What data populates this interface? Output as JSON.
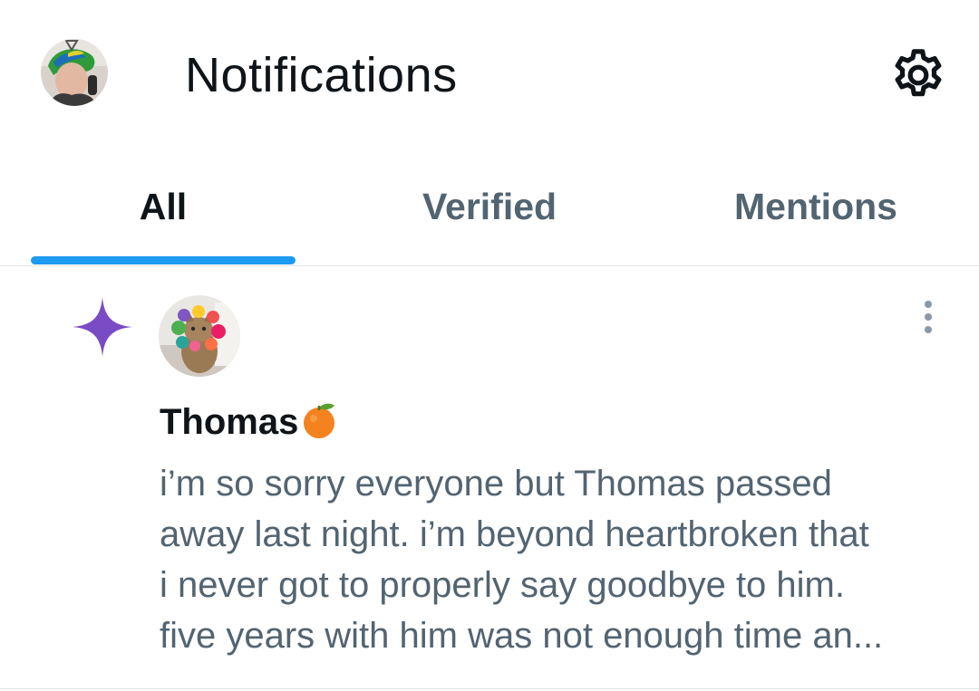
{
  "header": {
    "title": "Notifications",
    "settings_icon": "gear-icon"
  },
  "tabs": [
    {
      "label": "All",
      "active": true
    },
    {
      "label": "Verified",
      "active": false
    },
    {
      "label": "Mentions",
      "active": false
    }
  ],
  "colors": {
    "accent": "#1d9bf0",
    "sparkle": "#794bc4",
    "primary_text": "#0f1419",
    "secondary_text": "#536471"
  },
  "notification": {
    "type_icon": "sparkle-icon",
    "author": "Thomas",
    "author_emoji": "tangerine-emoji",
    "text_lines": [
      "i’m so sorry everyone but Thomas passed",
      "away last night. i’m beyond heartbroken that",
      "i never got to properly say goodbye to him.",
      "five years with him was not enough time an..."
    ]
  }
}
